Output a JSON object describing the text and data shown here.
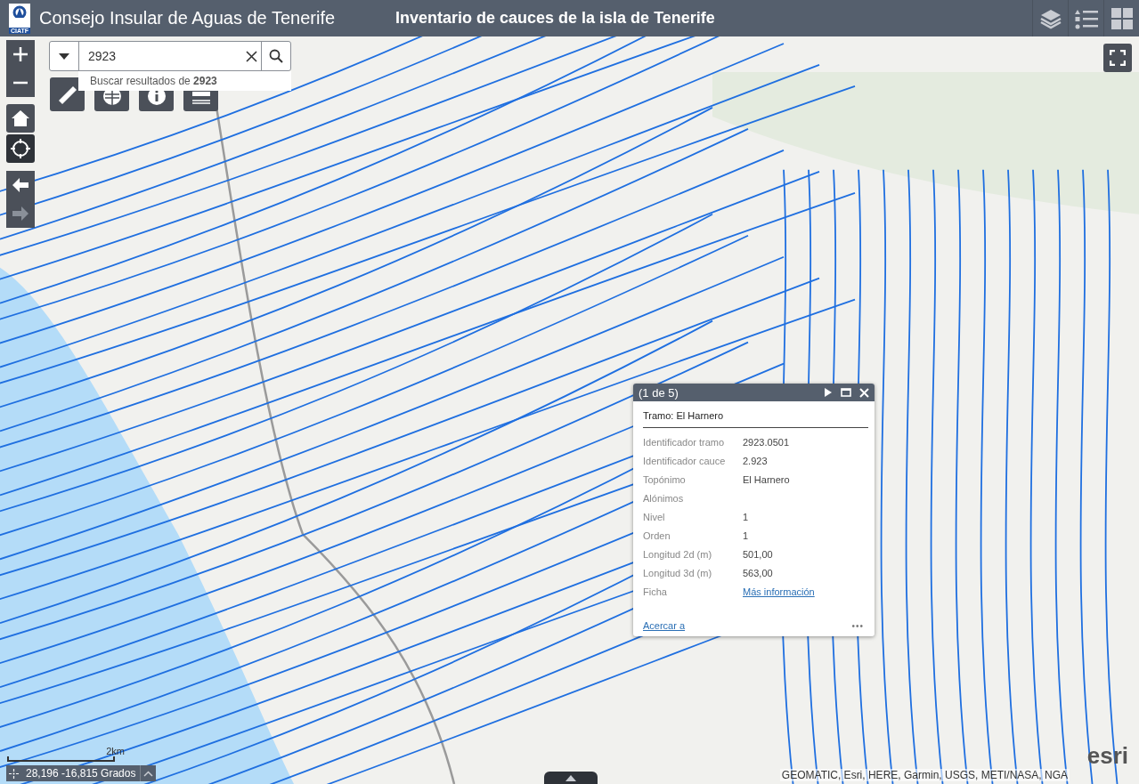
{
  "header": {
    "logo_text": "CIATF",
    "title": "Consejo Insular de Aguas de Tenerife",
    "subtitle": "Inventario de cauces de la isla de Tenerife"
  },
  "search": {
    "value": "2923",
    "suggestion": "Buscar resultados de **2923**"
  },
  "popup": {
    "counter": "(1 de 5)",
    "title": "Tramo: El Harnero",
    "fields": [
      {
        "label": "Identificador tramo",
        "value": "2923.0501",
        "kind": "text"
      },
      {
        "label": "Identificador cauce",
        "value": "2.923",
        "kind": "text"
      },
      {
        "label": "Topónimo",
        "value": "El Harnero",
        "kind": "text"
      },
      {
        "label": "Alónimos",
        "kind": "text"
      },
      {
        "label": "Nivel",
        "value": "1",
        "kind": "text"
      },
      {
        "label": "Orden",
        "value": "1",
        "kind": "text"
      },
      {
        "label": "Longitud 2d (m)",
        "value": "501,00",
        "kind": "text"
      },
      {
        "label": "Longitud 3d (m)",
        "value": "563,00",
        "kind": "text"
      },
      {
        "label": "Ficha",
        "value": "Más información",
        "kind": "link"
      }
    ],
    "zoom_link": "Acercar a",
    "more": "•••"
  },
  "scale": {
    "label": "2km"
  },
  "coordinates": "28,196 -16,815 Grados",
  "attribution": "GEOMATIC, Esri, HERE, Garmin, USGS, METI/NASA, NGA",
  "esri_logo": "esri"
}
